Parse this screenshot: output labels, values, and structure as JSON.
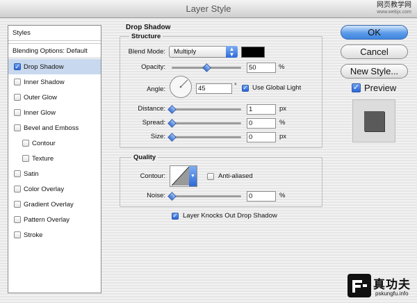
{
  "window": {
    "title": "Layer Style"
  },
  "watermark_top": {
    "line1": "网页教学网",
    "line2": "www.webjx.com"
  },
  "watermark_bottom": {
    "line1": "真功夫",
    "line2": "pskungfu.info"
  },
  "styles_panel": {
    "header": "Styles",
    "blending": "Blending Options: Default",
    "items": [
      {
        "label": "Drop Shadow",
        "checked": true,
        "selected": true
      },
      {
        "label": "Inner Shadow",
        "checked": false
      },
      {
        "label": "Outer Glow",
        "checked": false
      },
      {
        "label": "Inner Glow",
        "checked": false
      },
      {
        "label": "Bevel and Emboss",
        "checked": false
      },
      {
        "label": "Contour",
        "checked": false,
        "indent": true
      },
      {
        "label": "Texture",
        "checked": false,
        "indent": true
      },
      {
        "label": "Satin",
        "checked": false
      },
      {
        "label": "Color Overlay",
        "checked": false
      },
      {
        "label": "Gradient Overlay",
        "checked": false
      },
      {
        "label": "Pattern Overlay",
        "checked": false
      },
      {
        "label": "Stroke",
        "checked": false
      }
    ]
  },
  "drop_shadow": {
    "title": "Drop Shadow",
    "structure": {
      "title": "Structure",
      "blend_mode": {
        "label": "Blend Mode:",
        "value": "Multiply",
        "color": "#000000"
      },
      "opacity": {
        "label": "Opacity:",
        "value": "50",
        "unit": "%",
        "level": 0.5
      },
      "angle": {
        "label": "Angle:",
        "value": "45",
        "unit": "°"
      },
      "use_global_light": {
        "label": "Use Global Light",
        "checked": true
      },
      "distance": {
        "label": "Distance:",
        "value": "1",
        "unit": "px",
        "level": 0
      },
      "spread": {
        "label": "Spread:",
        "value": "0",
        "unit": "%",
        "level": 0
      },
      "size": {
        "label": "Size:",
        "value": "0",
        "unit": "px",
        "level": 0
      }
    },
    "quality": {
      "title": "Quality",
      "contour": {
        "label": "Contour:"
      },
      "anti_aliased": {
        "label": "Anti-aliased",
        "checked": false
      },
      "noise": {
        "label": "Noise:",
        "value": "0",
        "unit": "%",
        "level": 0
      }
    },
    "knockout": {
      "label": "Layer Knocks Out Drop Shadow",
      "checked": true
    }
  },
  "buttons": {
    "ok": "OK",
    "cancel": "Cancel",
    "new_style": "New Style...",
    "preview": "Preview",
    "preview_checked": true
  }
}
